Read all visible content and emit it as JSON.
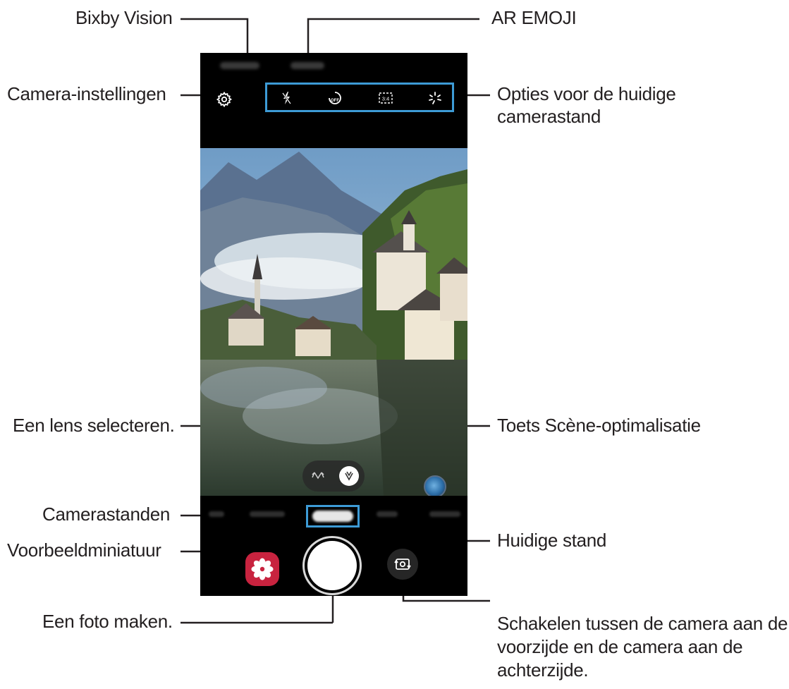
{
  "callouts": {
    "bixby_vision": "Bixby Vision",
    "ar_emoji": "AR EMOJI",
    "camera_settings": "Camera-instellingen",
    "mode_options_line1": "Opties voor de huidige",
    "mode_options_line2": "camerastand",
    "select_lens": "Een lens selecteren.",
    "scene_optimizer": "Toets Scène-optimalisatie",
    "camera_modes": "Camerastanden",
    "current_mode": "Huidige stand",
    "preview_thumbnail": "Voorbeeldminiatuur",
    "take_photo": "Een foto maken.",
    "switch_line1": "Schakelen tussen de camera aan de",
    "switch_line2": "voorzijde en de camera aan de",
    "switch_line3": "achterzijde."
  },
  "phone": {
    "options_icons": [
      "flash-off-icon",
      "timer-off-icon",
      "aspect-ratio-icon",
      "filter-icon"
    ],
    "aspect_ratio_text": "3:4",
    "timer_text": "OFF"
  },
  "colors": {
    "highlight": "#3d9bd6",
    "gallery_thumb": "#c8233f",
    "leader_line": "#231f20"
  }
}
